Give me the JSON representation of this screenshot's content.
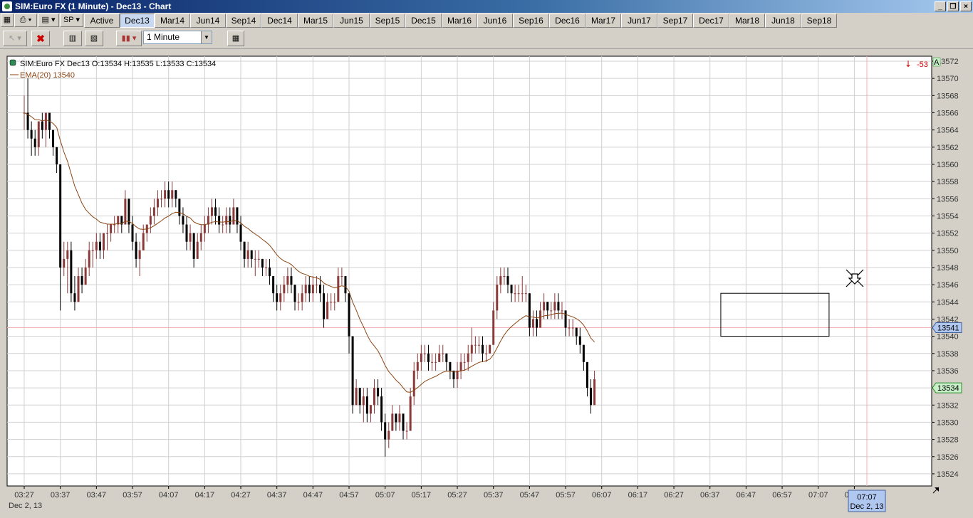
{
  "window": {
    "title": "SIM:Euro FX (1 Minute) - Dec13 - Chart",
    "controls": [
      "_",
      "❐",
      "×"
    ]
  },
  "tabbar": {
    "symbol": "SP",
    "tabs": [
      "Active",
      "Dec13",
      "Mar14",
      "Jun14",
      "Sep14",
      "Dec14",
      "Mar15",
      "Jun15",
      "Sep15",
      "Dec15",
      "Mar16",
      "Jun16",
      "Sep16",
      "Dec16",
      "Mar17",
      "Jun17",
      "Sep17",
      "Dec17",
      "Mar18",
      "Jun18",
      "Sep18"
    ],
    "selected": "Dec13"
  },
  "toolbar": {
    "interval": "1 Minute"
  },
  "legend": {
    "ohlc": "SIM:Euro FX Dec13 O:13534 H:13535 L:13533 C:13534",
    "ema": "EMA(20)  13540",
    "ema_color": "#8b4513"
  },
  "position": {
    "pnl": "-53",
    "pnl_color": "#cc0000"
  },
  "price_markers": {
    "last_price": "13534",
    "last_color": "#c8f0c8",
    "cross_price": "13541",
    "cross_color": "#b0c8f0",
    "axis_flag": "A"
  },
  "time_marker": {
    "time": "07:07",
    "date": "Dec 2, 13"
  },
  "chart_data": {
    "type": "candlestick",
    "y_ticks": [
      13572,
      13570,
      13568,
      13566,
      13564,
      13562,
      13560,
      13558,
      13556,
      13554,
      13552,
      13550,
      13548,
      13546,
      13544,
      13542,
      13540,
      13538,
      13536,
      13534,
      13532,
      13530,
      13528,
      13526,
      13524
    ],
    "x_ticks": [
      "03:27",
      "03:37",
      "03:47",
      "03:57",
      "04:07",
      "04:17",
      "04:27",
      "04:37",
      "04:47",
      "04:57",
      "05:07",
      "05:17",
      "05:27",
      "05:37",
      "05:47",
      "05:57",
      "06:07",
      "06:17",
      "06:27",
      "06:37",
      "06:47",
      "06:57",
      "07:07",
      "07:17"
    ],
    "x_date": "Dec 2, 13",
    "ylim": [
      13523,
      13572
    ],
    "grid": true,
    "up_color": "#8b3a3a",
    "down_color": "#000000",
    "ema_period": 20,
    "selection_box": {
      "start": "06:40",
      "end": "06:55",
      "low": 13540,
      "high": 13545
    },
    "bars": [
      [
        "03:27",
        13566,
        13568,
        13564,
        13566
      ],
      [
        "03:28",
        13566,
        13570,
        13563,
        13564
      ],
      [
        "03:29",
        13564,
        13565,
        13561,
        13563
      ],
      [
        "03:30",
        13563,
        13564,
        13561,
        13562
      ],
      [
        "03:31",
        13562,
        13565,
        13561,
        13565
      ],
      [
        "03:32",
        13565,
        13566,
        13563,
        13564
      ],
      [
        "03:33",
        13564,
        13566,
        13562,
        13566
      ],
      [
        "03:34",
        13566,
        13566,
        13563,
        13564
      ],
      [
        "03:35",
        13564,
        13564,
        13561,
        13562
      ],
      [
        "03:36",
        13562,
        13562,
        13559,
        13560
      ],
      [
        "03:37",
        13560,
        13560,
        13543,
        13548
      ],
      [
        "03:38",
        13548,
        13551,
        13547,
        13549
      ],
      [
        "03:39",
        13549,
        13551,
        13545,
        13550
      ],
      [
        "03:40",
        13550,
        13551,
        13544,
        13545
      ],
      [
        "03:41",
        13545,
        13547,
        13543,
        13544
      ],
      [
        "03:42",
        13544,
        13548,
        13544,
        13547
      ],
      [
        "03:43",
        13547,
        13548,
        13545,
        13546
      ],
      [
        "03:44",
        13546,
        13549,
        13546,
        13548
      ],
      [
        "03:45",
        13548,
        13551,
        13547,
        13550
      ],
      [
        "03:46",
        13550,
        13551,
        13548,
        13550
      ],
      [
        "03:47",
        13550,
        13552,
        13549,
        13551
      ],
      [
        "03:48",
        13551,
        13552,
        13549,
        13550
      ],
      [
        "03:49",
        13550,
        13552,
        13549,
        13552
      ],
      [
        "03:50",
        13552,
        13553,
        13550,
        13552
      ],
      [
        "03:51",
        13552,
        13553,
        13551,
        13553
      ],
      [
        "03:52",
        13553,
        13554,
        13552,
        13553
      ],
      [
        "03:53",
        13553,
        13554,
        13552,
        13554
      ],
      [
        "03:54",
        13554,
        13554,
        13552,
        13553
      ],
      [
        "03:55",
        13553,
        13557,
        13553,
        13556
      ],
      [
        "03:56",
        13556,
        13556,
        13552,
        13553
      ],
      [
        "03:57",
        13553,
        13554,
        13550,
        13551
      ],
      [
        "03:58",
        13551,
        13552,
        13548,
        13549
      ],
      [
        "03:59",
        13549,
        13551,
        13547,
        13550
      ],
      [
        "04:00",
        13550,
        13553,
        13550,
        13552
      ],
      [
        "04:01",
        13552,
        13553,
        13551,
        13553
      ],
      [
        "04:02",
        13553,
        13555,
        13552,
        13554
      ],
      [
        "04:03",
        13554,
        13556,
        13553,
        13555
      ],
      [
        "04:04",
        13555,
        13557,
        13554,
        13556
      ],
      [
        "04:05",
        13556,
        13557,
        13555,
        13556
      ],
      [
        "04:06",
        13556,
        13558,
        13555,
        13557
      ],
      [
        "04:07",
        13557,
        13558,
        13555,
        13556
      ],
      [
        "04:08",
        13556,
        13558,
        13555,
        13557
      ],
      [
        "04:09",
        13557,
        13557,
        13555,
        13556
      ],
      [
        "04:10",
        13556,
        13556,
        13553,
        13554
      ],
      [
        "04:11",
        13554,
        13555,
        13552,
        13553
      ],
      [
        "04:12",
        13553,
        13554,
        13550,
        13551
      ],
      [
        "04:13",
        13551,
        13553,
        13550,
        13552
      ],
      [
        "04:14",
        13552,
        13552,
        13548,
        13549
      ],
      [
        "04:15",
        13549,
        13552,
        13549,
        13551
      ],
      [
        "04:16",
        13551,
        13553,
        13550,
        13552
      ],
      [
        "04:17",
        13552,
        13554,
        13551,
        13553
      ],
      [
        "04:18",
        13553,
        13555,
        13552,
        13554
      ],
      [
        "04:19",
        13554,
        13556,
        13553,
        13555
      ],
      [
        "04:20",
        13555,
        13556,
        13553,
        13554
      ],
      [
        "04:21",
        13554,
        13555,
        13552,
        13553
      ],
      [
        "04:22",
        13553,
        13554,
        13552,
        13553
      ],
      [
        "04:23",
        13553,
        13555,
        13552,
        13554
      ],
      [
        "04:24",
        13554,
        13555,
        13552,
        13553
      ],
      [
        "04:25",
        13553,
        13556,
        13553,
        13555
      ],
      [
        "04:26",
        13555,
        13555,
        13552,
        13553
      ],
      [
        "04:27",
        13553,
        13554,
        13550,
        13551
      ],
      [
        "04:28",
        13551,
        13551,
        13548,
        13549
      ],
      [
        "04:29",
        13549,
        13551,
        13548,
        13550
      ],
      [
        "04:30",
        13550,
        13550,
        13548,
        13549
      ],
      [
        "04:31",
        13549,
        13550,
        13547,
        13549
      ],
      [
        "04:32",
        13549,
        13550,
        13548,
        13549
      ],
      [
        "04:33",
        13549,
        13549,
        13547,
        13548
      ],
      [
        "04:34",
        13548,
        13549,
        13547,
        13548
      ],
      [
        "04:35",
        13548,
        13549,
        13546,
        13547
      ],
      [
        "04:36",
        13547,
        13547,
        13544,
        13545
      ],
      [
        "04:37",
        13545,
        13546,
        13543,
        13544
      ],
      [
        "04:38",
        13544,
        13546,
        13543,
        13545
      ],
      [
        "04:39",
        13545,
        13547,
        13544,
        13546
      ],
      [
        "04:40",
        13546,
        13548,
        13545,
        13547
      ],
      [
        "04:41",
        13547,
        13548,
        13545,
        13546
      ],
      [
        "04:42",
        13546,
        13546,
        13543,
        13544
      ],
      [
        "04:43",
        13544,
        13545,
        13543,
        13544
      ],
      [
        "04:44",
        13544,
        13546,
        13543,
        13545
      ],
      [
        "04:45",
        13545,
        13547,
        13544,
        13546
      ],
      [
        "04:46",
        13546,
        13547,
        13544,
        13545
      ],
      [
        "04:47",
        13545,
        13547,
        13544,
        13546
      ],
      [
        "04:48",
        13546,
        13547,
        13545,
        13546
      ],
      [
        "04:49",
        13546,
        13547,
        13544,
        13545
      ],
      [
        "04:50",
        13545,
        13546,
        13541,
        13542
      ],
      [
        "04:51",
        13542,
        13545,
        13542,
        13544
      ],
      [
        "04:52",
        13544,
        13545,
        13543,
        13544
      ],
      [
        "04:53",
        13544,
        13545,
        13543,
        13544
      ],
      [
        "04:54",
        13544,
        13548,
        13544,
        13547
      ],
      [
        "04:55",
        13547,
        13548,
        13546,
        13547
      ],
      [
        "04:56",
        13547,
        13547,
        13544,
        13545
      ],
      [
        "04:57",
        13545,
        13545,
        13538,
        13540
      ],
      [
        "04:58",
        13540,
        13540,
        13531,
        13532
      ],
      [
        "04:59",
        13532,
        13535,
        13532,
        13534
      ],
      [
        "05:00",
        13534,
        13534,
        13531,
        13532
      ],
      [
        "05:01",
        13532,
        13534,
        13530,
        13533
      ],
      [
        "05:02",
        13533,
        13534,
        13530,
        13531
      ],
      [
        "05:03",
        13531,
        13532,
        13530,
        13532
      ],
      [
        "05:04",
        13532,
        13535,
        13531,
        13534
      ],
      [
        "05:05",
        13534,
        13535,
        13532,
        13533
      ],
      [
        "05:06",
        13533,
        13534,
        13529,
        13530
      ],
      [
        "05:07",
        13530,
        13531,
        13526,
        13528
      ],
      [
        "05:08",
        13528,
        13530,
        13527,
        13529
      ],
      [
        "05:09",
        13529,
        13532,
        13529,
        13531
      ],
      [
        "05:10",
        13531,
        13531,
        13529,
        13530
      ],
      [
        "05:11",
        13530,
        13532,
        13529,
        13531
      ],
      [
        "05:12",
        13531,
        13531,
        13528,
        13529
      ],
      [
        "05:13",
        13529,
        13530,
        13528,
        13529
      ],
      [
        "05:14",
        13529,
        13534,
        13529,
        13533
      ],
      [
        "05:15",
        13533,
        13537,
        13532,
        13536
      ],
      [
        "05:16",
        13536,
        13538,
        13535,
        13537
      ],
      [
        "05:17",
        13537,
        13539,
        13536,
        13538
      ],
      [
        "05:18",
        13538,
        13539,
        13537,
        13538
      ],
      [
        "05:19",
        13538,
        13539,
        13536,
        13537
      ],
      [
        "05:20",
        13537,
        13538,
        13536,
        13537
      ],
      [
        "05:21",
        13537,
        13538,
        13536,
        13537
      ],
      [
        "05:22",
        13537,
        13539,
        13537,
        13538
      ],
      [
        "05:23",
        13538,
        13539,
        13537,
        13538
      ],
      [
        "05:24",
        13538,
        13538,
        13536,
        13537
      ],
      [
        "05:25",
        13537,
        13537,
        13535,
        13536
      ],
      [
        "05:26",
        13536,
        13536,
        13534,
        13535
      ],
      [
        "05:27",
        13535,
        13537,
        13534,
        13536
      ],
      [
        "05:28",
        13536,
        13538,
        13535,
        13537
      ],
      [
        "05:29",
        13537,
        13538,
        13536,
        13537
      ],
      [
        "05:30",
        13537,
        13539,
        13536,
        13538
      ],
      [
        "05:31",
        13538,
        13541,
        13537,
        13539
      ],
      [
        "05:32",
        13539,
        13540,
        13538,
        13539
      ],
      [
        "05:33",
        13539,
        13540,
        13538,
        13539
      ],
      [
        "05:34",
        13539,
        13540,
        13537,
        13538
      ],
      [
        "05:35",
        13538,
        13539,
        13537,
        13538
      ],
      [
        "05:36",
        13538,
        13539,
        13538,
        13539
      ],
      [
        "05:37",
        13539,
        13544,
        13539,
        13543
      ],
      [
        "05:38",
        13543,
        13547,
        13542,
        13546
      ],
      [
        "05:39",
        13546,
        13548,
        13545,
        13547
      ],
      [
        "05:40",
        13547,
        13548,
        13546,
        13547
      ],
      [
        "05:41",
        13547,
        13548,
        13545,
        13546
      ],
      [
        "05:42",
        13546,
        13546,
        13544,
        13545
      ],
      [
        "05:43",
        13545,
        13546,
        13544,
        13545
      ],
      [
        "05:44",
        13545,
        13546,
        13544,
        13545
      ],
      [
        "05:45",
        13545,
        13547,
        13544,
        13545
      ],
      [
        "05:46",
        13545,
        13546,
        13544,
        13545
      ],
      [
        "05:47",
        13545,
        13545,
        13540,
        13541
      ],
      [
        "05:48",
        13541,
        13543,
        13540,
        13542
      ],
      [
        "05:49",
        13542,
        13543,
        13540,
        13541
      ],
      [
        "05:50",
        13541,
        13544,
        13541,
        13543
      ],
      [
        "05:51",
        13543,
        13545,
        13542,
        13544
      ],
      [
        "05:52",
        13544,
        13544,
        13542,
        13543
      ],
      [
        "05:53",
        13543,
        13544,
        13542,
        13543
      ],
      [
        "05:54",
        13543,
        13545,
        13542,
        13544
      ],
      [
        "05:55",
        13544,
        13545,
        13542,
        13543
      ],
      [
        "05:56",
        13543,
        13544,
        13542,
        13543
      ],
      [
        "05:57",
        13543,
        13543,
        13540,
        13541
      ],
      [
        "05:58",
        13541,
        13542,
        13540,
        13541
      ],
      [
        "05:59",
        13541,
        13542,
        13540,
        13541
      ],
      [
        "06:00",
        13541,
        13541,
        13539,
        13540
      ],
      [
        "06:01",
        13540,
        13541,
        13538,
        13539
      ],
      [
        "06:02",
        13539,
        13539,
        13536,
        13537
      ],
      [
        "06:03",
        13537,
        13537,
        13533,
        13534
      ],
      [
        "06:04",
        13534,
        13535,
        13531,
        13532
      ],
      [
        "06:05",
        13532,
        13536,
        13532,
        13535
      ]
    ]
  }
}
